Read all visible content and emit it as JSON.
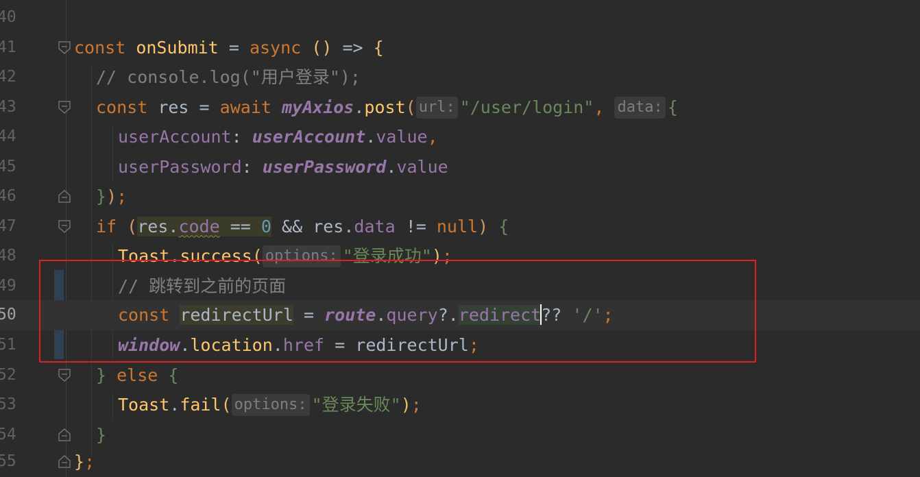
{
  "editor": {
    "line_numbers": [
      "40",
      "41",
      "42",
      "43",
      "44",
      "45",
      "46",
      "47",
      "48",
      "49",
      "50",
      "51",
      "52",
      "53",
      "54",
      "55"
    ],
    "current_line": "50",
    "hints": {
      "url": "url:",
      "data": "data:",
      "options": "options:"
    },
    "tokens": {
      "const": "const",
      "async": "async",
      "await": "await",
      "if": "if",
      "else": "else",
      "null": "null",
      "onSubmit": "onSubmit",
      "res": "res",
      "myAxios": "myAxios",
      "post": "post",
      "url_str": "\"/user/login\"",
      "userAccount_key": "userAccount",
      "userAccount_var": "userAccount",
      "value": "value",
      "userPassword_key": "userPassword",
      "userPassword_var": "userPassword",
      "code": "code",
      "zero": "0",
      "data_prop": "data",
      "Toast": "Toast",
      "success": "success",
      "fail": "fail",
      "success_str": "\"登录成功\"",
      "fail_str": "\"登录失败\"",
      "comment1": "// console.log(\"用户登录\");",
      "comment2": "// 跳转到之前的页面",
      "redirectUrl": "redirectUrl",
      "route": "route",
      "query": "query",
      "redirect": "redirect",
      "slash_str": "'/'",
      "window": "window",
      "location": "location",
      "href": "href"
    }
  }
}
